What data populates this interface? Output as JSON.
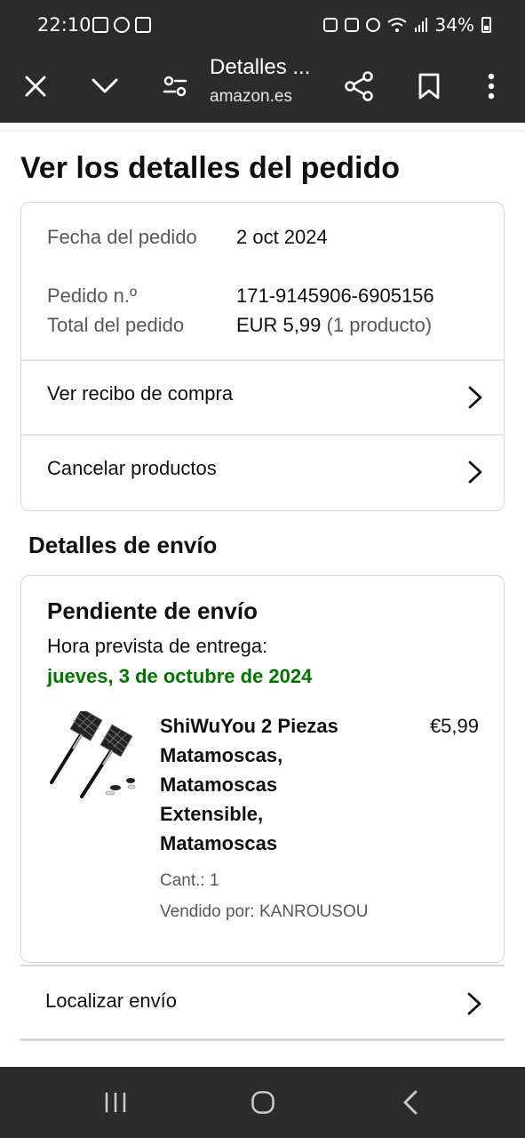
{
  "status_bar": {
    "time": "22:10",
    "battery": "34%"
  },
  "browser": {
    "title": "Detalles ...",
    "url": "amazon.es"
  },
  "page": {
    "title": "Ver los detalles del pedido"
  },
  "order_info": {
    "date_label": "Fecha del pedido",
    "date_value": "2 oct 2024",
    "number_label": "Pedido n.º",
    "number_value": "171-9145906-6905156",
    "total_label": "Total del pedido",
    "total_value": "EUR 5,99",
    "total_count": "(1 producto)"
  },
  "links": {
    "receipt": "Ver recibo de compra",
    "cancel": "Cancelar productos",
    "track": "Localizar envío"
  },
  "shipping": {
    "section_title": "Detalles de envío",
    "status": "Pendiente de envío",
    "eta_label": "Hora prevista de entrega:",
    "eta_date": "jueves, 3 de octubre de 2024"
  },
  "product": {
    "title": "ShiWuYou 2 Piezas Matamoscas, Matamoscas Extensible, Matamoscas",
    "price": "€5,99",
    "quantity": "Cant.: 1",
    "seller": "Vendido por: KANROUSOU"
  },
  "colors": {
    "delivery_green": "#007600",
    "bar_bg": "#2b2b2b"
  }
}
